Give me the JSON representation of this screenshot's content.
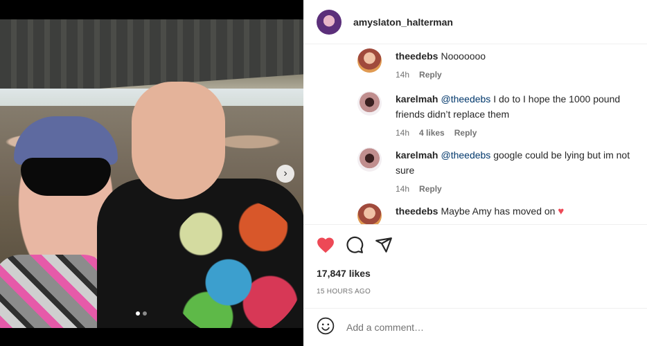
{
  "post": {
    "username": "amyslaton_halterman"
  },
  "carousel": {
    "next_label": "›",
    "slide_count": 2,
    "active_index": 0
  },
  "comments": [
    {
      "username": "theedebs",
      "mention": "",
      "text": "Nooooooo",
      "time": "14h",
      "likes": "",
      "reply_label": "Reply",
      "heart": ""
    },
    {
      "username": "karelmah",
      "mention": "@theedebs",
      "text": "I do to I hope the 1000 pound friends didn’t replace them",
      "time": "14h",
      "likes": "4 likes",
      "reply_label": "Reply",
      "heart": ""
    },
    {
      "username": "karelmah",
      "mention": "@theedebs",
      "text": "google could be lying but im not sure",
      "time": "14h",
      "likes": "",
      "reply_label": "Reply",
      "heart": ""
    },
    {
      "username": "theedebs",
      "mention": "",
      "text": "Maybe Amy has moved on",
      "time": "",
      "likes": "",
      "reply_label": "",
      "heart": "♥"
    }
  ],
  "actions": {
    "likes_count": "17,847 likes",
    "time_ago": "15 HOURS AGO"
  },
  "add_comment": {
    "placeholder": "Add a comment…"
  },
  "colors": {
    "like_red": "#ed4956",
    "mention_blue": "#00376b",
    "meta_gray": "#737373"
  }
}
